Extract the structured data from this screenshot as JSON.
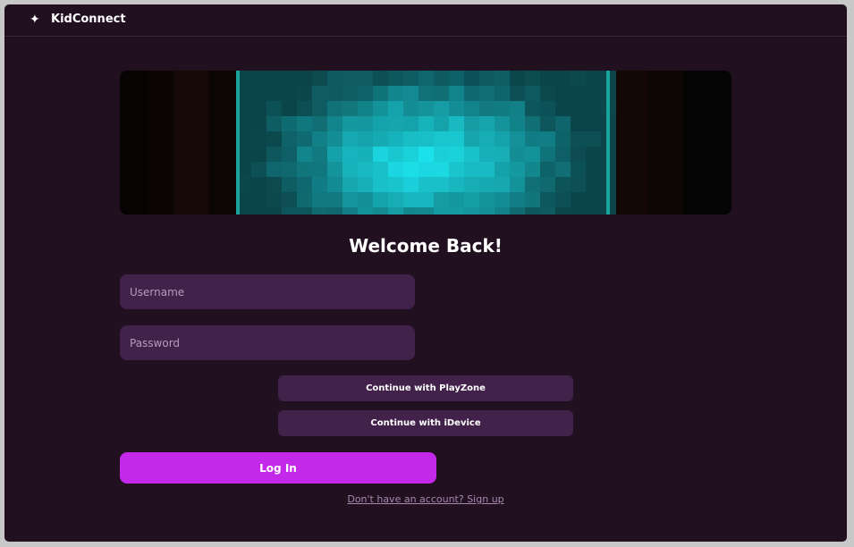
{
  "app": {
    "title": "KidConnect",
    "logo_icon": "sparkle-icon",
    "logo_glyph": "✦"
  },
  "hero": {
    "description_icon": "pixelated-glow-banner"
  },
  "login_form": {
    "heading": "Welcome Back!",
    "username_placeholder": "Username",
    "username_value": "",
    "password_placeholder": "Password",
    "password_value": "",
    "sso_playzone_label": "Continue with PlayZone",
    "sso_idevice_label": "Continue with iDevice",
    "login_label": "Log In",
    "signup_link": "Don't have an account? Sign up"
  },
  "colors": {
    "background": "#201020",
    "field_bg": "#42214a",
    "accent": "#c428e8",
    "hero_glow": "#14f0f5"
  }
}
